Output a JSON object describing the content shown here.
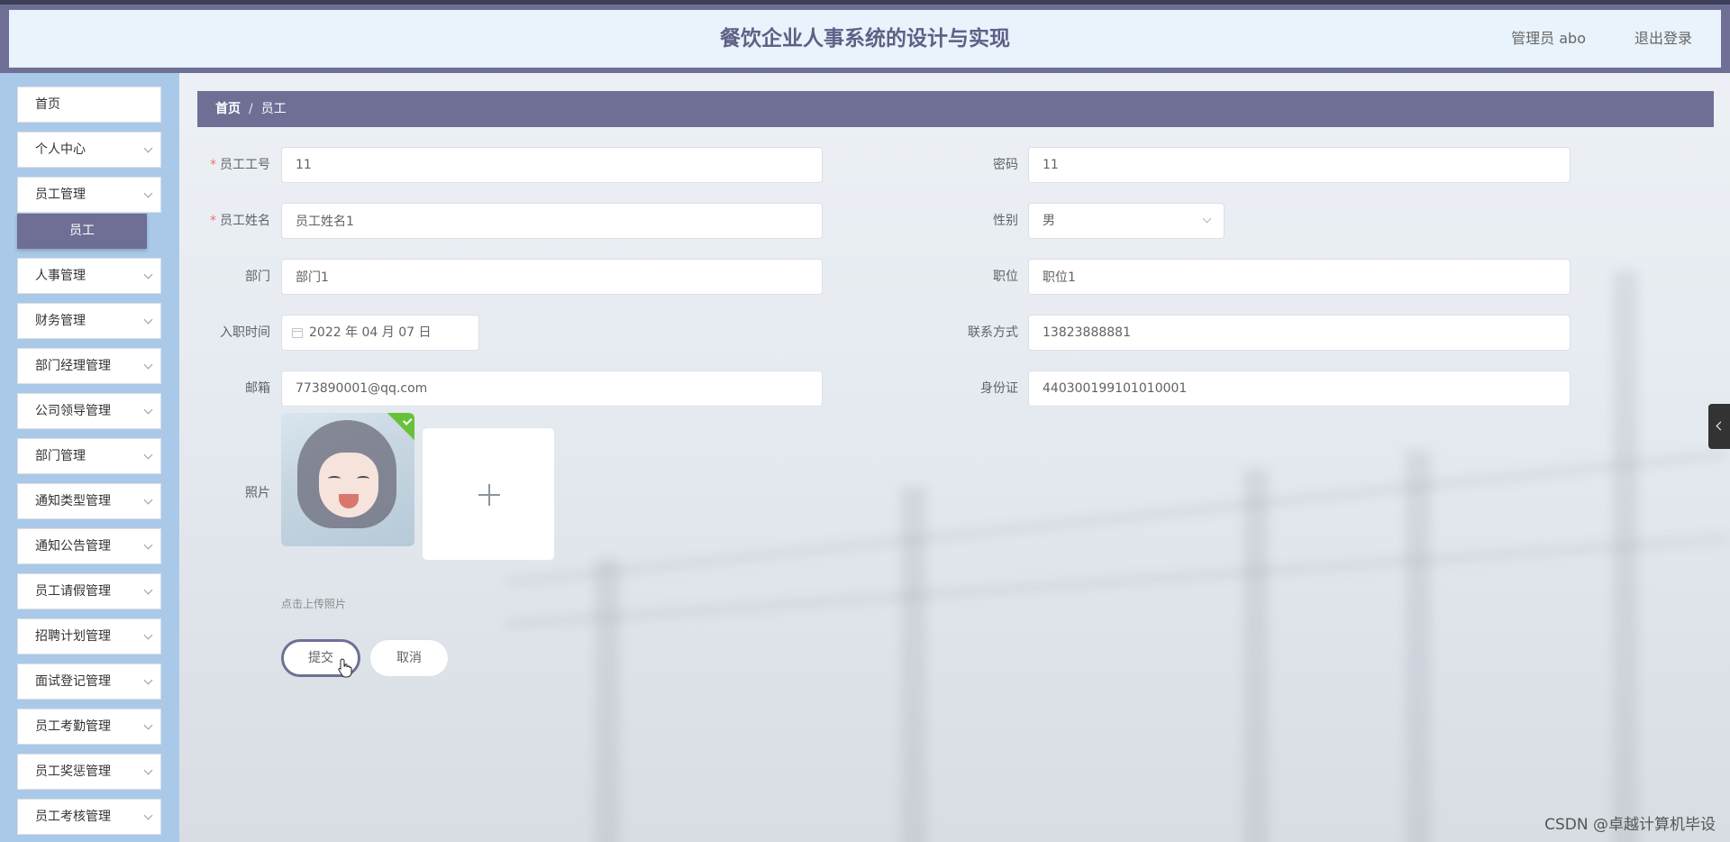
{
  "header": {
    "title": "餐饮企业人事系统的设计与实现",
    "user": "管理员 abo",
    "logout": "退出登录"
  },
  "sidebar": {
    "items": [
      {
        "label": "首页",
        "expandable": false
      },
      {
        "label": "个人中心",
        "expandable": true
      },
      {
        "label": "员工管理",
        "expandable": true,
        "expanded": true
      },
      {
        "label": "人事管理",
        "expandable": true
      },
      {
        "label": "财务管理",
        "expandable": true
      },
      {
        "label": "部门经理管理",
        "expandable": true
      },
      {
        "label": "公司领导管理",
        "expandable": true
      },
      {
        "label": "部门管理",
        "expandable": true
      },
      {
        "label": "通知类型管理",
        "expandable": true
      },
      {
        "label": "通知公告管理",
        "expandable": true
      },
      {
        "label": "员工请假管理",
        "expandable": true
      },
      {
        "label": "招聘计划管理",
        "expandable": true
      },
      {
        "label": "面试登记管理",
        "expandable": true
      },
      {
        "label": "员工考勤管理",
        "expandable": true
      },
      {
        "label": "员工奖惩管理",
        "expandable": true
      },
      {
        "label": "员工考核管理",
        "expandable": true
      }
    ],
    "active_sub": "员工"
  },
  "breadcrumb": {
    "home": "首页",
    "separator": "/",
    "current": "员工"
  },
  "form": {
    "employee_no": {
      "label": "员工工号",
      "value": "11",
      "required": true
    },
    "password": {
      "label": "密码",
      "value": "11"
    },
    "employee_name": {
      "label": "员工姓名",
      "value": "员工姓名1",
      "required": true
    },
    "gender": {
      "label": "性别",
      "value": "男"
    },
    "department": {
      "label": "部门",
      "value": "部门1"
    },
    "position": {
      "label": "职位",
      "value": "职位1"
    },
    "hire_date": {
      "label": "入职时间",
      "value": "2022 年 04 月 07 日"
    },
    "contact": {
      "label": "联系方式",
      "value": "13823888881"
    },
    "email": {
      "label": "邮箱",
      "value": "773890001@qq.com"
    },
    "id_card": {
      "label": "身份证",
      "value": "440300199101010001"
    },
    "photo": {
      "label": "照片",
      "tip": "点击上传照片",
      "uploaded": true
    },
    "submit_label": "提交",
    "cancel_label": "取消"
  },
  "watermark": "CSDN @卓越计算机毕设",
  "colors": {
    "accent": "#6f6f96",
    "sidebar_bg": "#aac9e8",
    "header_bg": "#e8f3fc",
    "required": "#f56c6c",
    "success": "#67c23a"
  }
}
